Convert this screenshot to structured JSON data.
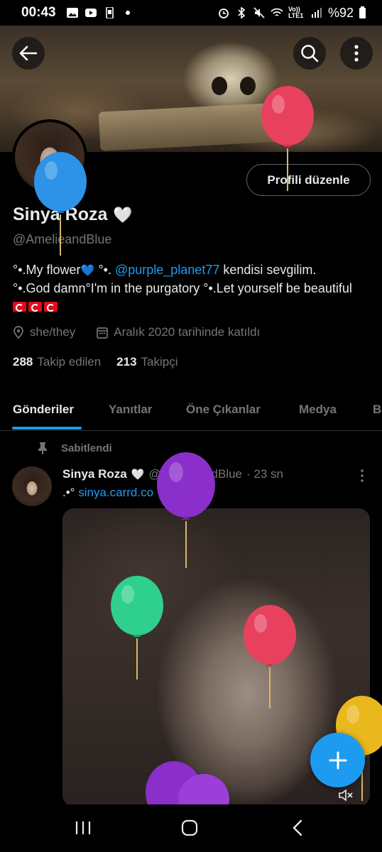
{
  "status_bar": {
    "time": "00:43",
    "network": "Vo)) LTE1",
    "battery": "%92"
  },
  "profile": {
    "name": "Sinya Roza",
    "name_emoji": "🤍",
    "handle": "@AmelieandBlue",
    "edit_label": "Profili düzenle",
    "bio_line1_pre": "°•.My flower",
    "bio_heart": "💙",
    "bio_line1_mid": " °•. ",
    "bio_mention": "@purple_planet77",
    "bio_line1_post": " kendisi sevgilim.",
    "bio_line2": "°•.God damn°I'm in the purgatory  °•.Let yourself be beautiful",
    "pronouns": "she/they",
    "joined": "Aralık 2020 tarihinde katıldı",
    "following_count": "288",
    "following_label": "Takip edilen",
    "followers_count": "213",
    "followers_label": "Takipçi"
  },
  "tabs": [
    {
      "label": "Gönderiler",
      "active": true
    },
    {
      "label": "Yanıtlar"
    },
    {
      "label": "Öne Çıkanlar"
    },
    {
      "label": "Medya"
    },
    {
      "label": "B"
    }
  ],
  "pinned_post": {
    "pinned_label": "Sabitlendi",
    "author": "Sinya Roza",
    "author_emoji": "🤍",
    "handle": "@AmelieandBlue",
    "time": "· 23 sn",
    "text_pre": ".•°",
    "link": "sinya.carrd.co",
    "text_post": "°."
  },
  "icons": {
    "back": "arrow-left-icon",
    "search": "search-icon",
    "more": "more-vertical-icon",
    "location": "location-pin-icon",
    "calendar": "calendar-icon",
    "pin": "pin-icon",
    "compose": "plus-icon",
    "mute": "volume-mute-icon"
  },
  "colors": {
    "accent": "#1d9bf0",
    "text_primary": "#e7e9ea",
    "text_secondary": "#71767b",
    "background": "#000000",
    "balloon_red": "#e8415e",
    "balloon_blue": "#2c93e8",
    "balloon_purple": "#8a2fc9",
    "balloon_green": "#2fd08e",
    "balloon_yellow": "#e9b81c"
  }
}
